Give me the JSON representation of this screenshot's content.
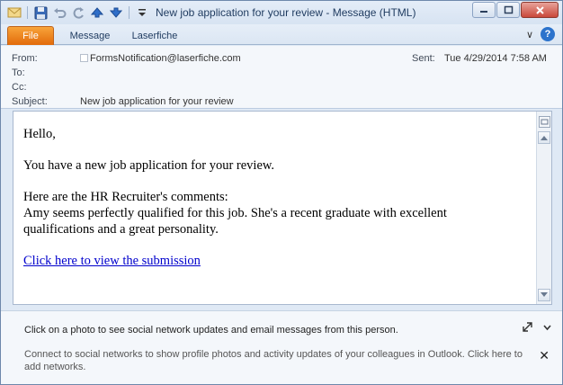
{
  "window": {
    "title": "New job application for your review  -  Message (HTML)",
    "accent_color": "#e26a0a",
    "link_color": "#0000cc"
  },
  "quick_access_toolbar": {
    "icons": [
      "mail-icon",
      "save-icon",
      "undo-icon",
      "redo-icon",
      "up-arrow-icon",
      "down-arrow-icon",
      "customize-dropdown-icon"
    ]
  },
  "window_controls": {
    "minimize_glyph": "–",
    "maximize_glyph": "□",
    "close_glyph": "✕"
  },
  "ribbon": {
    "tabs": [
      {
        "label": "File"
      },
      {
        "label": "Message"
      },
      {
        "label": "Laserfiche"
      }
    ],
    "collapse_glyph": "∨",
    "help_glyph": "?"
  },
  "header": {
    "from_label": "From:",
    "from_value": "FormsNotification@laserfiche.com",
    "to_label": "To:",
    "to_value": "",
    "cc_label": "Cc:",
    "cc_value": "",
    "subject_label": "Subject:",
    "subject_value": "New job application for your review",
    "sent_label": "Sent:",
    "sent_value": "Tue 4/29/2014 7:58 AM"
  },
  "body": {
    "greeting": "Hello,",
    "line1": "You have a new job application for your review.",
    "comments_intro": "Here are the HR Recruiter's comments:",
    "comment_line1": "Amy seems perfectly qualified for this job. She's a recent graduate with excellent",
    "comment_line2": "qualifications and a great personality.",
    "link_text": "Click here to view the submission"
  },
  "social_pane": {
    "title": "Click on a photo to see social network updates and email messages from this person.",
    "description": "Connect to social networks to show profile photos and activity updates of your colleagues in Outlook. Click here to add networks.",
    "close_glyph": "✕"
  }
}
